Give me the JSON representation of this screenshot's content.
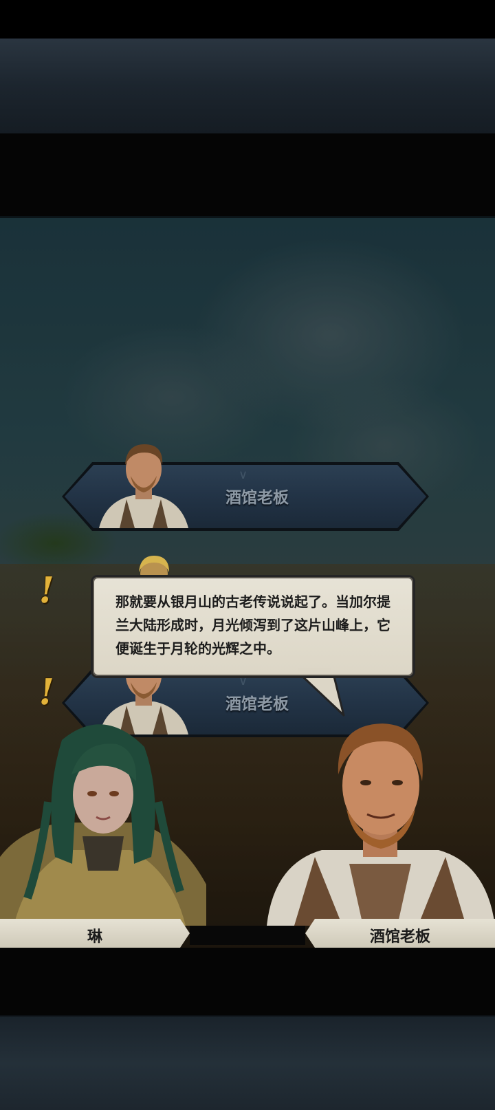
{
  "dialogue_log": [
    {
      "speaker": "酒馆老板"
    },
    {
      "speaker": "酒馆老板"
    }
  ],
  "current_line": {
    "speaker": "酒馆老板",
    "text": "那就要从银月山的古老传说说起了。当加尔提兰大陆形成时，月光倾泻到了这片山峰上，它便诞生于月轮的光辉之中。"
  },
  "characters": {
    "left": {
      "name": "琳"
    },
    "right": {
      "name": "酒馆老板"
    }
  },
  "markers": {
    "alert": "!"
  },
  "colors": {
    "banner": "#24364a",
    "bubble": "#e3dfd1",
    "alert": "#e2b23a",
    "nameplate": "#dcd7c7"
  }
}
